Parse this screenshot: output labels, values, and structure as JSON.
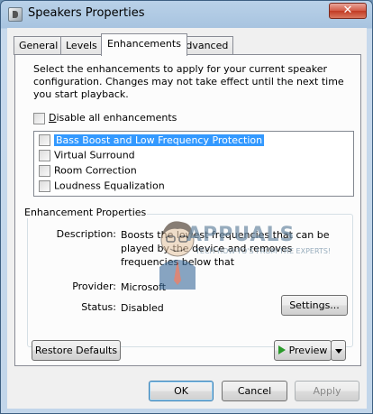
{
  "window": {
    "title": "Speakers Properties",
    "close_glyph": "✕"
  },
  "tabs": [
    {
      "label": "General"
    },
    {
      "label": "Levels"
    },
    {
      "label": "Enhancements",
      "active": true
    },
    {
      "label": "Advanced"
    }
  ],
  "enhancements": {
    "intro": "Select the enhancements to apply for your current speaker configuration. Changes may not take effect until the next time you start playback.",
    "disable_all": {
      "underline": "D",
      "rest": "isable all enhancements",
      "checked": false
    },
    "items": [
      {
        "label": "Bass Boost and Low Frequency Protection",
        "checked": false,
        "selected": true
      },
      {
        "label": "Virtual Surround",
        "checked": false,
        "selected": false
      },
      {
        "label": "Room Correction",
        "checked": false,
        "selected": false
      },
      {
        "label": "Loudness Equalization",
        "checked": false,
        "selected": false
      }
    ]
  },
  "properties": {
    "title": "Enhancement Properties",
    "description_label": "Description:",
    "description_value": "Boosts the lowest frequencies that can be played by the device and removes frequencies below that",
    "provider_label": "Provider:",
    "provider_value": "Microsoft",
    "status_label": "Status:",
    "status_value": "Disabled",
    "settings_button": "Settings..."
  },
  "buttons": {
    "restore_defaults": "Restore Defaults",
    "preview": "Preview",
    "ok": "OK",
    "cancel": "Cancel",
    "apply": "Apply"
  },
  "watermark": {
    "brand": "APPUALS",
    "tagline": "TECH HOW-TO'S FROM THE EXPERTS!"
  },
  "colors": {
    "selection": "#3399ff",
    "title_bar": "#a8c4e0",
    "close_button": "#c23a23"
  }
}
